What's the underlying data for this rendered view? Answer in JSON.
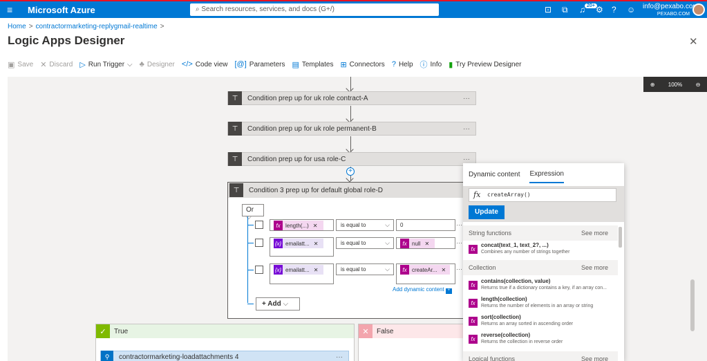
{
  "topbar": {
    "brand": "Microsoft Azure",
    "search_placeholder": "Search resources, services, and docs (G+/)",
    "notif_count": "20+",
    "user_email": "info@pexabo.com",
    "user_org": "PEXABO.COM"
  },
  "breadcrumb": {
    "home": "Home",
    "resource": "contractormarketing-replygmail-realtime"
  },
  "page": {
    "title": "Logic Apps Designer",
    "more": "···"
  },
  "toolbar": {
    "save": "Save",
    "discard": "Discard",
    "run_trigger": "Run Trigger",
    "designer": "Designer",
    "code_view": "Code view",
    "parameters": "Parameters",
    "templates": "Templates",
    "connectors": "Connectors",
    "help": "Help",
    "info": "Info",
    "try_preview": "Try Preview Designer"
  },
  "zoom": {
    "level": "100%"
  },
  "steps": [
    {
      "title": "Condition prep up for uk role contract-A",
      "more": "···"
    },
    {
      "title": "Condition prep up for uk role permanent-B",
      "more": "···"
    },
    {
      "title": "Condition prep up for usa role-C",
      "more": "···"
    }
  ],
  "condition": {
    "title": "Condition 3 prep up for default global role-D",
    "group_operator": "Or",
    "rows": [
      {
        "left": "length(...)",
        "operator": "is equal to",
        "right": "0"
      },
      {
        "left": "emailatt...",
        "operator": "is equal to",
        "right": "null"
      },
      {
        "left": "emailatt...",
        "operator": "is equal to",
        "right": "createAr..."
      }
    ],
    "add_dynamic": "Add dynamic content",
    "add_button": "Add",
    "row_more": "···"
  },
  "branches": {
    "true_label": "True",
    "false_label": "False",
    "inner_step": "contractormarketing-loadattachments 4",
    "inner_more": "···"
  },
  "panel": {
    "tabs": [
      "Dynamic content",
      "Expression"
    ],
    "expression_value": "createArray()",
    "update": "Update",
    "see_more": "See more",
    "sections": {
      "string": "String functions",
      "collection": "Collection",
      "logical": "Logical functions"
    },
    "items": [
      {
        "name": "concat(text_1, text_2?, ...)",
        "desc": "Combines any number of strings together"
      },
      {
        "name": "contains(collection, value)",
        "desc": "Returns true if a dictionary contains a key, if an array con..."
      },
      {
        "name": "length(collection)",
        "desc": "Returns the number of elements in an array or string"
      },
      {
        "name": "sort(collection)",
        "desc": "Returns an array sorted in ascending order"
      },
      {
        "name": "reverse(collection)",
        "desc": "Returns the collection in reverse order"
      }
    ]
  },
  "colors": {
    "azure_blue": "#0078d4",
    "fx_token": "#ad008c",
    "var_token": "#770bd6",
    "true_green": "#7fba00",
    "false_red": "#f3a5ad"
  }
}
